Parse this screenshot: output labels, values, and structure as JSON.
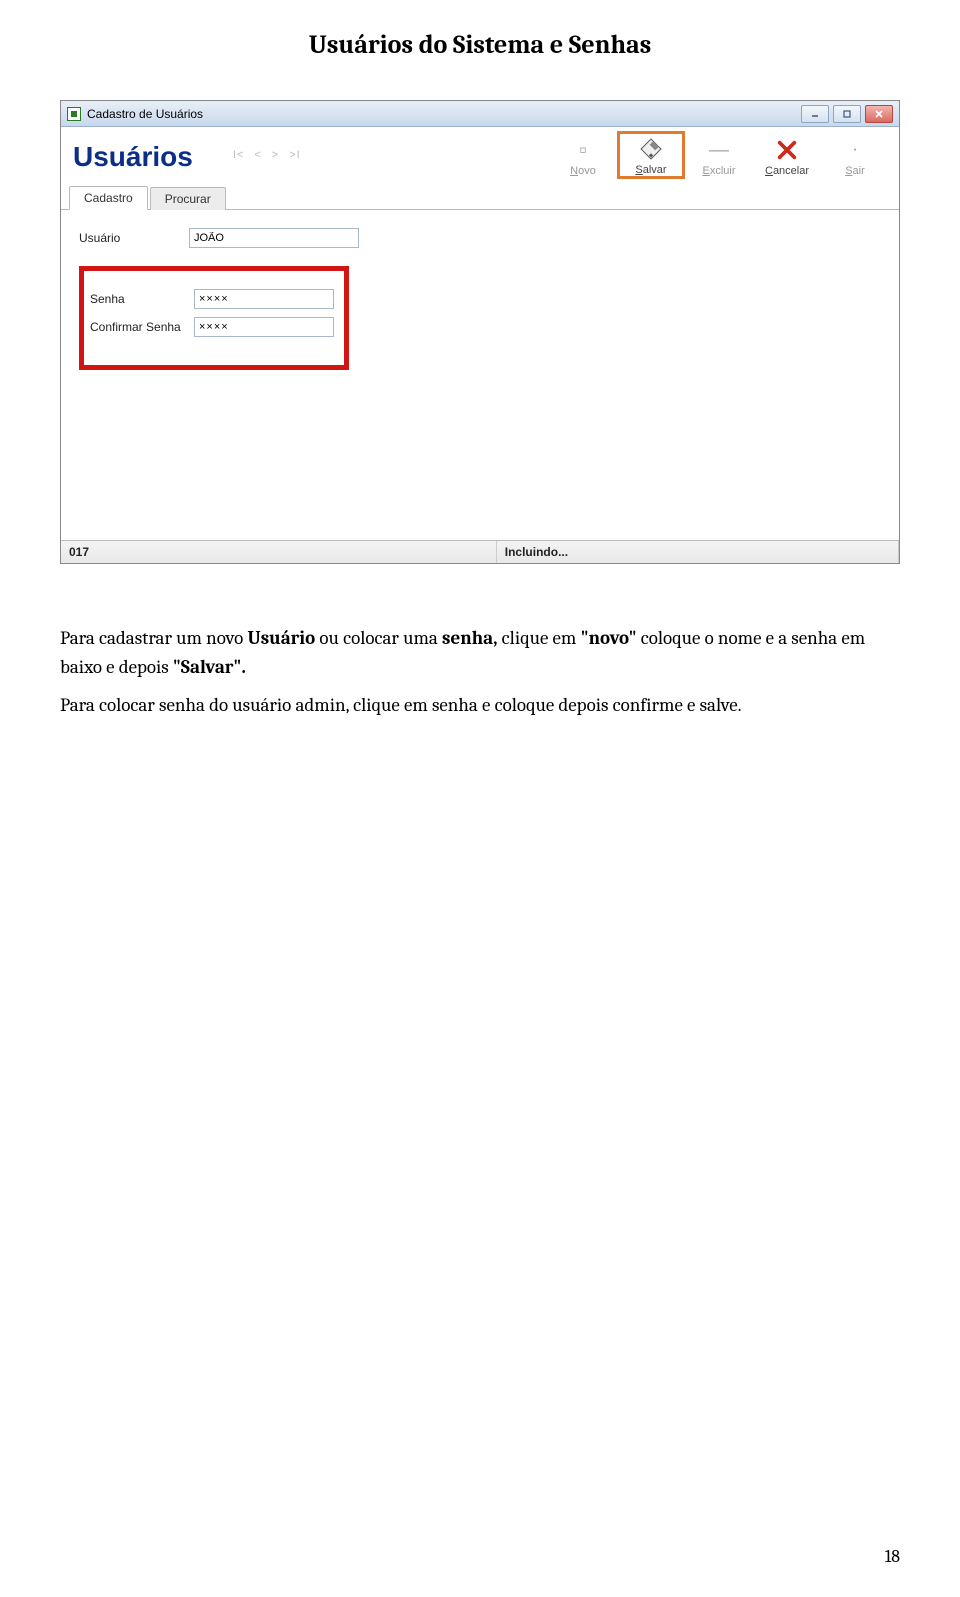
{
  "doc": {
    "title": "Usuários do Sistema e Senhas",
    "page_number": "18"
  },
  "window": {
    "title": "Cadastro de Usuários",
    "section_label": "Usuários",
    "toolbar": {
      "novo": "Novo",
      "salvar": "Salvar",
      "excluir": "Excluir",
      "cancelar": "Cancelar",
      "sair": "Sair"
    },
    "tabs": {
      "cadastro": "Cadastro",
      "procurar": "Procurar"
    },
    "form": {
      "usuario_label": "Usuário",
      "usuario_value": "JOÃO",
      "senha_label": "Senha",
      "senha_value": "××××",
      "confirmar_label": "Confirmar Senha",
      "confirmar_value": "××××"
    },
    "status": {
      "left": "017",
      "right": "Incluindo..."
    }
  },
  "body": {
    "p1_a": "Para cadastrar um novo ",
    "p1_b": "Usuário",
    "p1_c": " ou colocar uma ",
    "p1_d": "senha,",
    "p1_e": " clique em ",
    "p1_f": "\"novo\"",
    "p1_g": " coloque o nome e a senha em baixo e depois ",
    "p1_h": "\"Salvar\".",
    "p2": "Para colocar senha do usuário admin, clique em senha e coloque depois confirme e salve."
  }
}
